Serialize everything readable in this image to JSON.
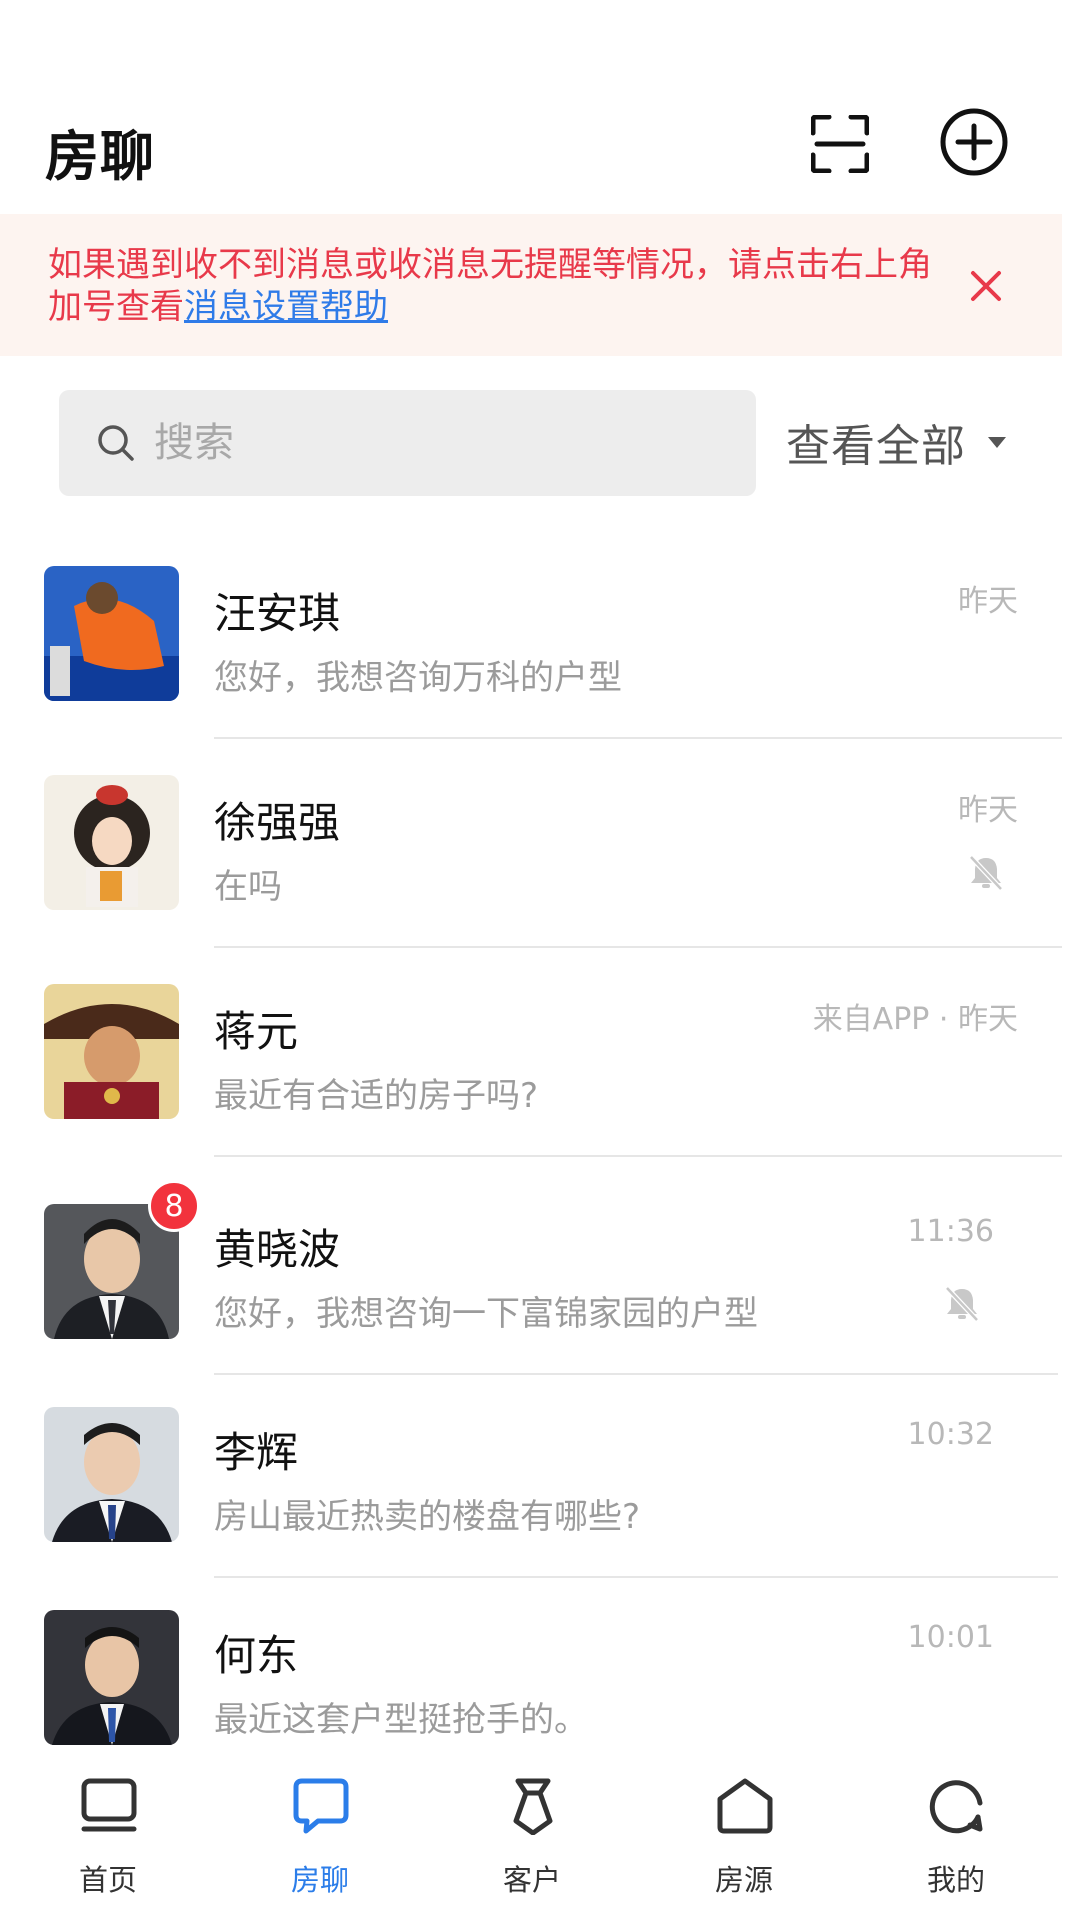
{
  "header": {
    "title": "房聊"
  },
  "notice": {
    "text": "如果遇到收不到消息或收消息无提醒等情况，请点击右上角加号查看",
    "link": "消息设置帮助",
    "color_text": "#e8394a",
    "color_link": "#2f7be8",
    "background": "#fdf4f0"
  },
  "search": {
    "placeholder": "搜索"
  },
  "filter": {
    "label": "查看全部"
  },
  "chats": [
    {
      "name": "汪安琪",
      "preview": "您好，我想咨询万科的户型",
      "time": "昨天",
      "muted": false,
      "unread": null,
      "avatar": "orange-jacket-photo"
    },
    {
      "name": "徐强强",
      "preview": "在吗",
      "time": "昨天",
      "muted": true,
      "unread": null,
      "avatar": "illustrated-girl"
    },
    {
      "name": "蒋元",
      "preview": "最近有合适的房子吗?",
      "time": "来自APP · 昨天",
      "muted": false,
      "unread": null,
      "avatar": "pirate-cartoon"
    },
    {
      "name": "黄晓波",
      "preview": "您好，我想咨询一下富锦家园的户型",
      "time": "11:36",
      "muted": true,
      "unread": "8",
      "avatar": "man-portrait"
    },
    {
      "name": "李辉",
      "preview": "房山最近热卖的楼盘有哪些?",
      "time": "10:32",
      "muted": false,
      "unread": null,
      "avatar": "man-portrait"
    },
    {
      "name": "何东",
      "preview": "最近这套户型挺抢手的。",
      "time": "10:01",
      "muted": false,
      "unread": null,
      "avatar": "man-portrait"
    }
  ],
  "tabbar": {
    "active_color": "#2b7de9",
    "items": [
      {
        "label": "首页",
        "icon": "monitor-icon",
        "active": false
      },
      {
        "label": "房聊",
        "icon": "chat-icon",
        "active": true
      },
      {
        "label": "客户",
        "icon": "tie-icon",
        "active": false
      },
      {
        "label": "房源",
        "icon": "house-icon",
        "active": false
      },
      {
        "label": "我的",
        "icon": "profile-circle-icon",
        "active": false
      }
    ]
  }
}
